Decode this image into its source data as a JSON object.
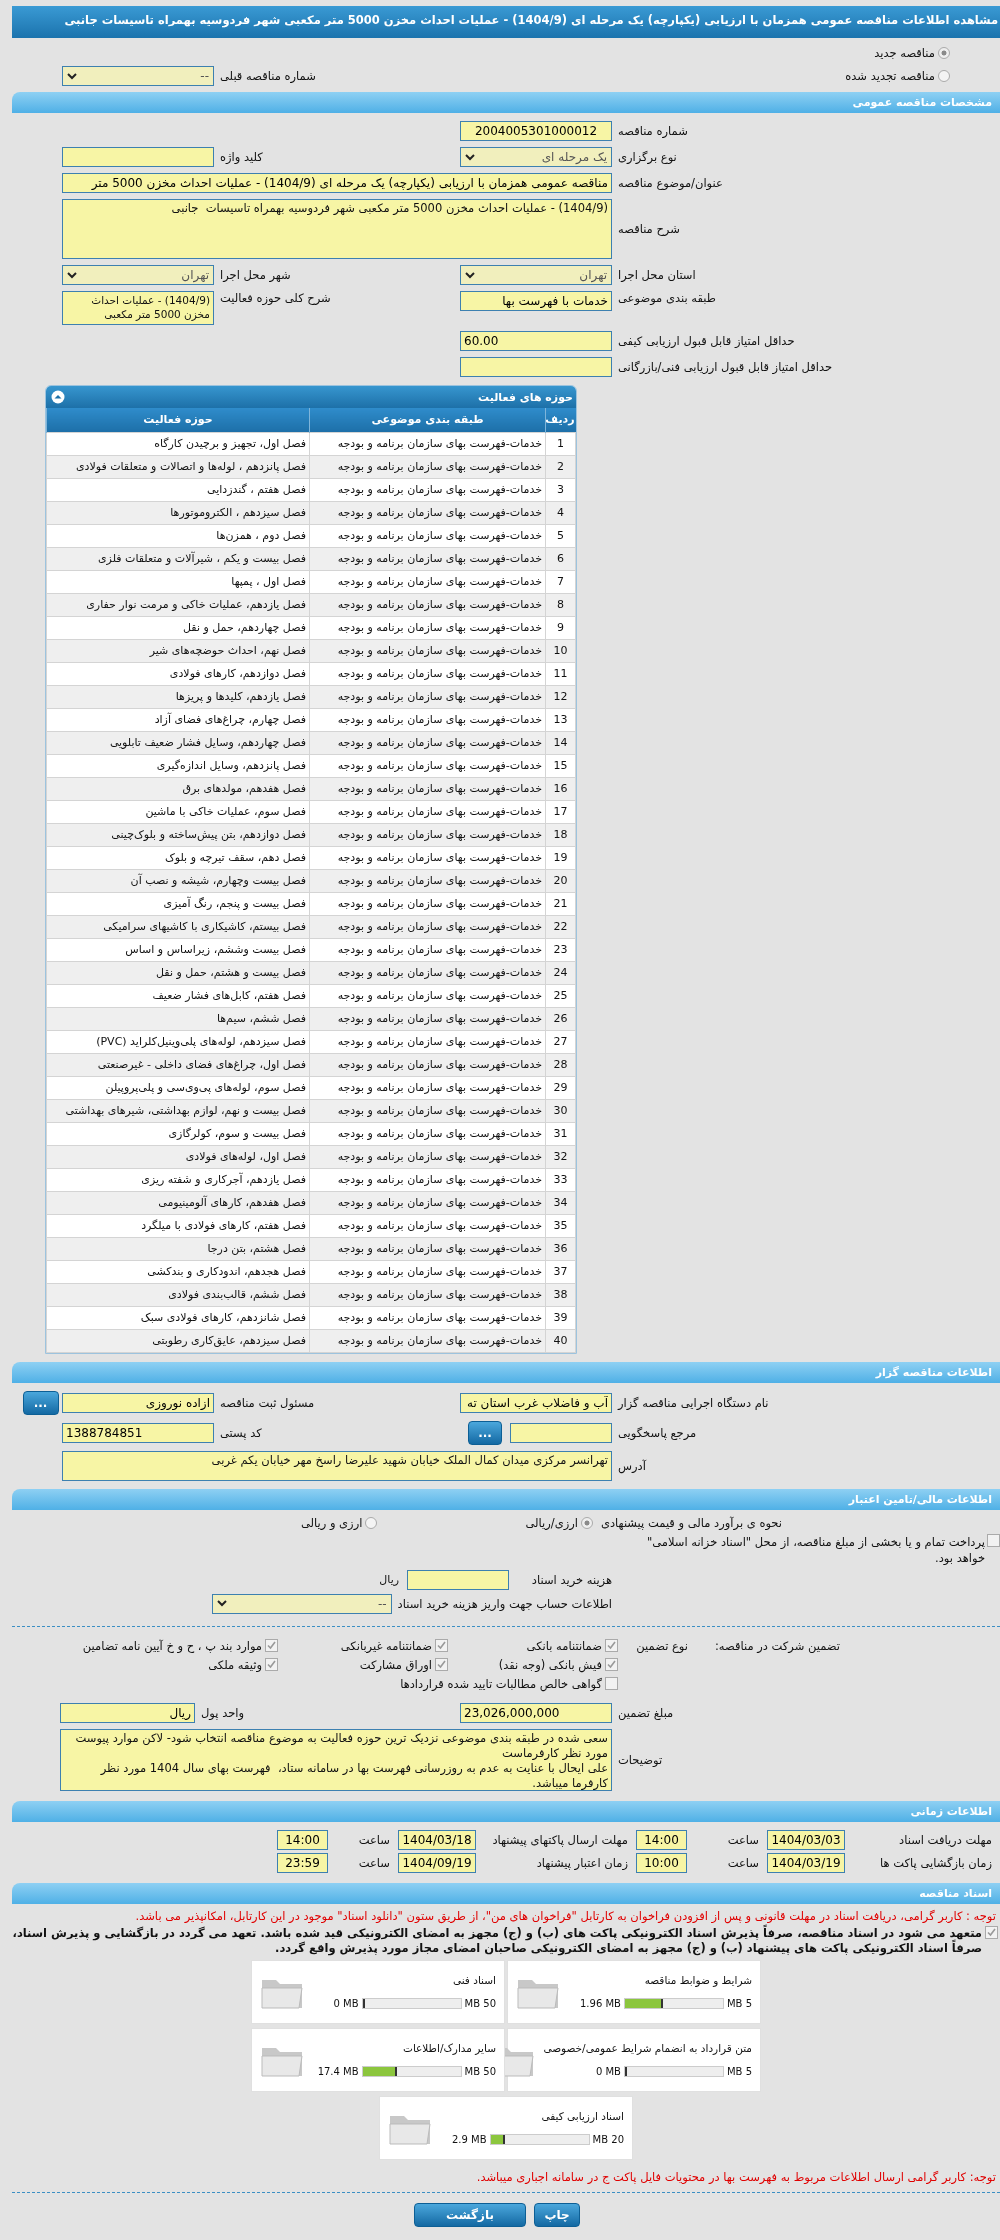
{
  "page_title": "مشاهده اطلاعات مناقصه عمومی همزمان با ارزیابی (یکپارچه) یک مرحله ای (1404/9) - عملیات احداث مخزن 5000 متر مکعبی شهر فردوسیه بهمراه تاسیسات جانبی",
  "tender_type": [
    {
      "label": "مناقصه جدید",
      "selected": true
    },
    {
      "label": "مناقصه تجدید شده",
      "selected": false
    }
  ],
  "previous_tender": {
    "label": "شماره مناقصه قبلی",
    "value": "--"
  },
  "general": {
    "header": "مشخصات مناقصه عمومی",
    "tender_number": {
      "label": "شماره مناقصه",
      "value": "2004005301000012"
    },
    "holding_type": {
      "label": "نوع برگزاری",
      "value": "یک مرحله ای"
    },
    "keyword": {
      "label": "کلید واژه"
    },
    "subject": {
      "label": "عنوان/موضوع مناقصه",
      "value": "مناقصه عمومی همزمان با ارزیابی (یکپارچه) یک مرحله ای (1404/9) - عملیات احداث مخزن 5000 متر"
    },
    "description": {
      "label": "شرح مناقصه",
      "value": "(1404/9) - عملیات احداث مخزن 5000 متر مکعبی شهر فردوسیه بهمراه تاسیسات  جانبی"
    },
    "province": {
      "label": "استان محل اجرا",
      "value": "تهران"
    },
    "city": {
      "label": "شهر محل اجرا",
      "value": "تهران"
    },
    "category": {
      "label": "طبقه بندی موضوعی",
      "value": "خدمات با فهرست بها"
    },
    "activity_summary": {
      "label": "شرح کلی حوزه فعالیت",
      "value": "(1404/9) - عملیات احداث مخزن 5000 متر مکعبی"
    },
    "min_quality_score": {
      "label": "حداقل امتیاز قابل قبول ارزیابی کیفی",
      "value": "60.00"
    },
    "min_technical_score": {
      "label": "حداقل امتیاز قابل قبول ارزیابی فنی/بازرگانی"
    }
  },
  "activities": {
    "header": "حوزه های فعالیت",
    "columns": [
      "ردیف",
      "طبقه بندی موضوعی",
      "حوزه فعالیت"
    ],
    "rows": [
      {
        "number": "1",
        "category": "خدمات-فهرست بهای سازمان برنامه و بودجه",
        "activity": "فصل اول، تجهیز و برچیدن کارگاه"
      },
      {
        "number": "2",
        "category": "خدمات-فهرست بهای سازمان برنامه و بودجه",
        "activity": "فصل پانزدهم ، لوله‌ها و اتصالات و متعلقات فولادی"
      },
      {
        "number": "3",
        "category": "خدمات-فهرست بهای سازمان برنامه و بودجه",
        "activity": "فصل هفتم ، گندزدایی"
      },
      {
        "number": "4",
        "category": "خدمات-فهرست بهای سازمان برنامه و بودجه",
        "activity": "فصل سیزدهم ، الکتروموتورها"
      },
      {
        "number": "5",
        "category": "خدمات-فهرست بهای سازمان برنامه و بودجه",
        "activity": "فصل دوم ، همزن‌ها"
      },
      {
        "number": "6",
        "category": "خدمات-فهرست بهای سازمان برنامه و بودجه",
        "activity": "فصل بیست و یکم ، شیرآلات و متعلقات فلزی"
      },
      {
        "number": "7",
        "category": "خدمات-فهرست بهای سازمان برنامه و بودجه",
        "activity": "فصل اول ، پمپها"
      },
      {
        "number": "8",
        "category": "خدمات-فهرست بهای سازمان برنامه و بودجه",
        "activity": "فصل یازدهم، عملیات خاکی و مرمت نوار حفاری"
      },
      {
        "number": "9",
        "category": "خدمات-فهرست بهای سازمان برنامه و بودجه",
        "activity": "فصل چهاردهم، حمل و نقل"
      },
      {
        "number": "10",
        "category": "خدمات-فهرست بهای سازمان برنامه و بودجه",
        "activity": "فصل نهم، احداث حوضچه‌های شیر"
      },
      {
        "number": "11",
        "category": "خدمات-فهرست بهای سازمان برنامه و بودجه",
        "activity": "فصل دوازدهم، کارهای فولادی"
      },
      {
        "number": "12",
        "category": "خدمات-فهرست بهای سازمان برنامه و بودجه",
        "activity": "فصل یازدهم، کلیدها و پریزها"
      },
      {
        "number": "13",
        "category": "خدمات-فهرست بهای سازمان برنامه و بودجه",
        "activity": "فصل چهارم، چراغ‌های فضای آزاد"
      },
      {
        "number": "14",
        "category": "خدمات-فهرست بهای سازمان برنامه و بودجه",
        "activity": "فصل چهاردهم، وسایل فشار ضعیف تابلویی"
      },
      {
        "number": "15",
        "category": "خدمات-فهرست بهای سازمان برنامه و بودجه",
        "activity": "فصل پانزدهم، وسایل اندازه‌گیری"
      },
      {
        "number": "16",
        "category": "خدمات-فهرست بهای سازمان برنامه و بودجه",
        "activity": "فصل هفدهم، مولدهای برق"
      },
      {
        "number": "17",
        "category": "خدمات-فهرست بهای سازمان برنامه و بودجه",
        "activity": "فصل سوم، عملیات خاکی با ماشین"
      },
      {
        "number": "18",
        "category": "خدمات-فهرست بهای سازمان برنامه و بودجه",
        "activity": "فصل دوازدهم، بتن پیش‌ساخته و بلوک‌چینی"
      },
      {
        "number": "19",
        "category": "خدمات-فهرست بهای سازمان برنامه و بودجه",
        "activity": "فصل دهم، سقف تیرچه و بلوک"
      },
      {
        "number": "20",
        "category": "خدمات-فهرست بهای سازمان برنامه و بودجه",
        "activity": "فصل بیست وچهارم، شیشه و نصب آن"
      },
      {
        "number": "21",
        "category": "خدمات-فهرست بهای سازمان برنامه و بودجه",
        "activity": "فصل بیست و پنجم، رنگ آمیزی"
      },
      {
        "number": "22",
        "category": "خدمات-فهرست بهای سازمان برنامه و بودجه",
        "activity": "فصل بیستم، کاشیکاری با کاشیهای سرامیکی"
      },
      {
        "number": "23",
        "category": "خدمات-فهرست بهای سازمان برنامه و بودجه",
        "activity": "فصل بیست وششم، زیراساس و اساس"
      },
      {
        "number": "24",
        "category": "خدمات-فهرست بهای سازمان برنامه و بودجه",
        "activity": "فصل بیست و هشتم، حمل و نقل"
      },
      {
        "number": "25",
        "category": "خدمات-فهرست بهای سازمان برنامه و بودجه",
        "activity": "فصل هفتم، کابل‌های فشار ضعیف"
      },
      {
        "number": "26",
        "category": "خدمات-فهرست بهای سازمان برنامه و بودجه",
        "activity": "فصل ششم، سیم‌ها"
      },
      {
        "number": "27",
        "category": "خدمات-فهرست بهای سازمان برنامه و بودجه",
        "activity": "فصل سیزدهم، لوله‌های پلی‌وینیل‌کلراید (PVC)"
      },
      {
        "number": "28",
        "category": "خدمات-فهرست بهای سازمان برنامه و بودجه",
        "activity": "فصل اول، چراغ‌های فضای داخلی - غیرصنعتی"
      },
      {
        "number": "29",
        "category": "خدمات-فهرست بهای سازمان برنامه و بودجه",
        "activity": "فصل سوم، لوله‌های پی‌وی‌سی و پلی‌پروپیلن"
      },
      {
        "number": "30",
        "category": "خدمات-فهرست بهای سازمان برنامه و بودجه",
        "activity": "فصل بیست و نهم، لوازم بهداشتی، شیرهای بهداشتی"
      },
      {
        "number": "31",
        "category": "خدمات-فهرست بهای سازمان برنامه و بودجه",
        "activity": "فصل بیست و سوم، کولرگازی"
      },
      {
        "number": "32",
        "category": "خدمات-فهرست بهای سازمان برنامه و بودجه",
        "activity": "فصل اول، لوله‌های فولادی"
      },
      {
        "number": "33",
        "category": "خدمات-فهرست بهای سازمان برنامه و بودجه",
        "activity": "فصل یازدهم، آجرکاری و شفته ریزی"
      },
      {
        "number": "34",
        "category": "خدمات-فهرست بهای سازمان برنامه و بودجه",
        "activity": "فصل هفدهم، کارهای آلومینیومی"
      },
      {
        "number": "35",
        "category": "خدمات-فهرست بهای سازمان برنامه و بودجه",
        "activity": "فصل هفتم، کارهای فولادی با میلگرد"
      },
      {
        "number": "36",
        "category": "خدمات-فهرست بهای سازمان برنامه و بودجه",
        "activity": "فصل هشتم، بتن درجا"
      },
      {
        "number": "37",
        "category": "خدمات-فهرست بهای سازمان برنامه و بودجه",
        "activity": "فصل هجدهم، اندودکاری و بندکشی"
      },
      {
        "number": "38",
        "category": "خدمات-فهرست بهای سازمان برنامه و بودجه",
        "activity": "فصل ششم، قالب‌بندی فولادی"
      },
      {
        "number": "39",
        "category": "خدمات-فهرست بهای سازمان برنامه و بودجه",
        "activity": "فصل شانزدهم، کارهای فولادی سبک"
      },
      {
        "number": "40",
        "category": "خدمات-فهرست بهای سازمان برنامه و بودجه",
        "activity": "فصل سیزدهم، عایق‌کاری رطوبتی"
      }
    ]
  },
  "organizer": {
    "header": "اطلاعات مناقصه گزار",
    "org_name": {
      "label": "نام دستگاه اجرایی مناقصه گزار",
      "value": "آب و فاضلاب غرب استان ته"
    },
    "registrar": {
      "label": "مسئول ثبت مناقصه",
      "value": "ازاده نوروزی",
      "button": "..."
    },
    "reference": {
      "label": "مرجع پاسخگویی",
      "button": "..."
    },
    "postal_code": {
      "label": "کد پستی",
      "value": "1388784851"
    },
    "address": {
      "label": "آدرس",
      "value": "تهرانسر مرکزی میدان کمال الملک خیابان شهید علیرضا راسخ مهر خیابان یکم غربی"
    }
  },
  "finance": {
    "header": "اطلاعات مالی/تامین اعتبار",
    "estimate_label": "نحوه ی برآورد مالی و قیمت پیشنهادی",
    "currency_options": [
      {
        "label": "ارزی/ریالی",
        "selected": true
      },
      {
        "label": "ارزی و ریالی",
        "selected": false
      }
    ],
    "treasury_payment": {
      "label": "پرداخت تمام و یا بخشی از مبلغ مناقصه، از محل \"اسناد خزانه اسلامی\" خواهد بود.",
      "checked": false
    },
    "document_cost": {
      "label": "هزینه خرید اسناد",
      "unit": "ریال"
    },
    "account": {
      "label": "اطلاعات حساب جهت واریز هزینه خرید اسناد",
      "value": "--"
    }
  },
  "guarantee": {
    "label": "تضمین شرکت در مناقصه:",
    "type_label": "نوع تضمین",
    "options": [
      {
        "label": "ضمانتنامه بانکی",
        "checked": true
      },
      {
        "label": "ضمانتنامه غیربانکی",
        "checked": true
      },
      {
        "label": "موارد بند پ ، ح و خ آیین نامه تضامین",
        "checked": true
      },
      {
        "label": "فیش بانکی (وجه نقد)",
        "checked": true
      },
      {
        "label": "اوراق مشارکت",
        "checked": true
      },
      {
        "label": "وثیقه ملکی",
        "checked": true
      },
      {
        "label": "گواهی خالص مطالبات تایید شده قراردادها",
        "checked": false
      }
    ],
    "amount": {
      "label": "مبلغ تضمین",
      "value": "23,026,000,000"
    },
    "currency_unit": {
      "label": "واحد پول",
      "value": "ریال"
    },
    "notes": {
      "label": "توضیحات",
      "value": "سعی شده در طبقه بندی موضوعی نزدیک ترین حوزه فعالیت به موضوع مناقصه انتخاب شود- لاکن موارد پیوست مورد نظر کارفرماست\nعلی ایحال با عنایت به عدم به روزرسانی فهرست بها در سامانه ستاد،  فهرست بهای سال 1404 مورد نظر کارفرما میباشد."
    }
  },
  "times": {
    "header": "اطلاعات زمانی",
    "items": [
      {
        "label": "مهلت دریافت اسناد",
        "date": "1404/03/03",
        "time_label": "ساعت",
        "time": "14:00"
      },
      {
        "label": "مهلت ارسال پاکتهای پیشنهاد",
        "date": "1404/03/18",
        "time_label": "ساعت",
        "time": "14:00"
      },
      {
        "label": "زمان بازگشایی پاکت ها",
        "date": "1404/03/19",
        "time_label": "ساعت",
        "time": "10:00"
      },
      {
        "label": "زمان اعتبار پیشنهاد",
        "date": "1404/09/19",
        "time_label": "ساعت",
        "time": "23:59"
      }
    ]
  },
  "documents": {
    "header": "اسناد مناقصه",
    "notice": "توجه : کاربر گرامی، دریافت اسناد در مهلت قانونی و پس از افزودن فراخوان به کارتابل \"فراخوان های من\"، از طریق ستون \"دانلود اسناد\" موجود در این کارتابل، امکانپذیر می باشد.",
    "commitment": {
      "text": "متعهد می شود در اسناد مناقصه، صرفاً پذیرش اسناد الکترونیکی پاکت های (ب) و (ج) مجهز به امضای الکترونیکی قید شده باشد. تعهد می گردد در بازگشایی و پذیرش اسناد، صرفاً اسناد الکترونیکی پاکت های پیشنهاد (ب) و (ج) مجهز به امضای الکترونیکی صاحبان امضای مجاز مورد پذیرش واقع گردد.",
      "checked": true
    },
    "files": [
      {
        "name": "شرایط و ضوابط مناقصه",
        "used": "1.96 MB",
        "max": "5 MB",
        "level": 0.39
      },
      {
        "name": "اسناد فنی",
        "used": "0 MB",
        "max": "50 MB",
        "level": 0
      },
      {
        "name": "متن قرارداد به انضمام شرایط عمومی/خصوصی",
        "used": "0 MB",
        "max": "5 MB",
        "level": 0
      },
      {
        "name": "سایر مدارک/اطلاعات",
        "used": "17.4 MB",
        "max": "50 MB",
        "level": 0.35
      },
      {
        "name": "اسناد ارزیابی کیفی",
        "used": "2.9 MB",
        "max": "20 MB",
        "level": 0.145
      }
    ],
    "footer_notice": "توجه: کاربر گرامی ارسال اطلاعات مربوط به فهرست بها در محتویات فایل پاکت ج در سامانه اجباری میباشد."
  },
  "buttons": [
    {
      "label": "چاپ"
    },
    {
      "label": "بازگشت"
    }
  ]
}
